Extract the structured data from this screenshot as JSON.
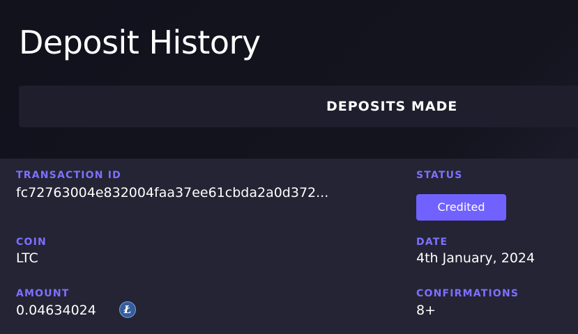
{
  "page": {
    "title": "Deposit History"
  },
  "tabs": [
    {
      "label": "DEPOSITS MADE",
      "active": true
    }
  ],
  "deposit": {
    "transaction_id_label": "TRANSACTION ID",
    "transaction_id": "fc72763004e832004faa37ee61cbda2a0d372...",
    "status_label": "STATUS",
    "status": "Credited",
    "coin_label": "COIN",
    "coin": "LTC",
    "date_label": "DATE",
    "date": "4th January, 2024",
    "amount_label": "AMOUNT",
    "amount": "0.04634024",
    "amount_icon": "litecoin-icon",
    "amount_icon_glyph": "Ł",
    "confirmations_label": "CONFIRMATIONS",
    "confirmations": "8+"
  },
  "colors": {
    "background": "#14141f",
    "tab_bar": "#1e1e2d",
    "card": "#242434",
    "accent_label": "#7e70ff",
    "status_button": "#7162ff",
    "litecoin": "#345d9d"
  }
}
